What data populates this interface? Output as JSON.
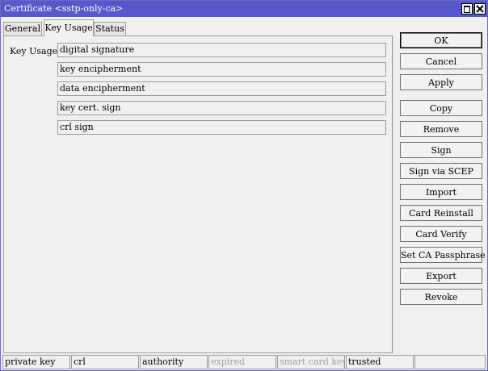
{
  "window": {
    "title": "Certificate <sstp-only-ca>"
  },
  "tabs": [
    {
      "label": "General"
    },
    {
      "label": "Key Usage"
    },
    {
      "label": "Status"
    }
  ],
  "active_tab": "Key Usage",
  "key_usage": {
    "label": "Key Usage:",
    "values": [
      "digital signature",
      "key encipherment",
      "data encipherment",
      "key cert. sign",
      "crl sign"
    ]
  },
  "buttons": [
    {
      "label": "OK"
    },
    {
      "label": "Cancel"
    },
    {
      "label": "Apply"
    },
    {
      "label": "Copy"
    },
    {
      "label": "Remove"
    },
    {
      "label": "Sign"
    },
    {
      "label": "Sign via SCEP"
    },
    {
      "label": "Import"
    },
    {
      "label": "Card Reinstall"
    },
    {
      "label": "Card Verify"
    },
    {
      "label": "Set CA Passphrase"
    },
    {
      "label": "Export"
    },
    {
      "label": "Revoke"
    }
  ],
  "status_bar": [
    {
      "label": "private key",
      "enabled": true
    },
    {
      "label": "crl",
      "enabled": true
    },
    {
      "label": "authority",
      "enabled": true
    },
    {
      "label": "expired",
      "enabled": false
    },
    {
      "label": "smart card key",
      "enabled": false
    },
    {
      "label": "trusted",
      "enabled": true
    },
    {
      "label": "",
      "enabled": true
    }
  ],
  "colors": {
    "titlebar": "#5858cc",
    "window_bg": "#f0f0f0",
    "disabled_text": "#a0a0a0"
  }
}
